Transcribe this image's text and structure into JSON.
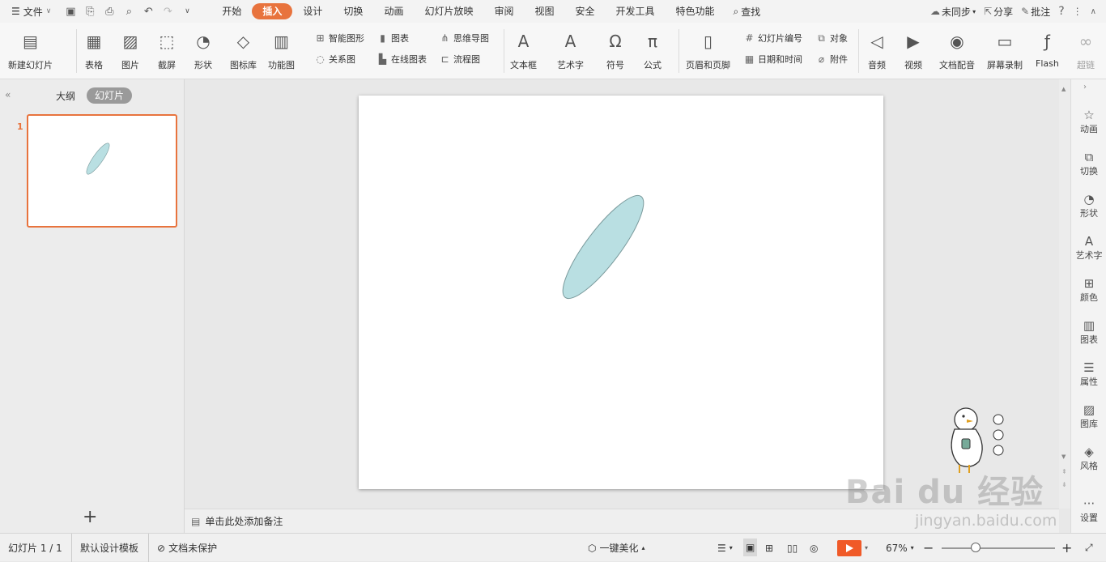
{
  "menubar": {
    "file_label": "文件",
    "tabs": [
      "开始",
      "插入",
      "设计",
      "切换",
      "动画",
      "幻灯片放映",
      "审阅",
      "视图",
      "安全",
      "开发工具",
      "特色功能"
    ],
    "active_tab": 1,
    "search_label": "查找",
    "sync_label": "未同步",
    "share_label": "分享",
    "comment_label": "批注"
  },
  "ribbon": {
    "new_slide": "新建幻灯片",
    "table": "表格",
    "picture": "图片",
    "screenshot": "截屏",
    "shape": "形状",
    "icon_lib": "图标库",
    "func_chart": "功能图",
    "smart_shape": "智能图形",
    "chart": "图表",
    "mindmap": "思维导图",
    "relation": "关系图",
    "online_chart": "在线图表",
    "flowchart": "流程图",
    "textbox": "文本框",
    "wordart": "艺术字",
    "symbol": "符号",
    "formula": "公式",
    "header_footer": "页眉和页脚",
    "slide_number": "幻灯片编号",
    "object": "对象",
    "datetime": "日期和时间",
    "attachment": "附件",
    "audio": "音频",
    "video": "视频",
    "doc_audio": "文档配音",
    "screen_record": "屏幕录制",
    "flash": "Flash",
    "hyperlink": "超链"
  },
  "leftpanel": {
    "outline_tab": "大纲",
    "slides_tab": "幻灯片",
    "slide_num": "1"
  },
  "notes_placeholder": "单击此处添加备注",
  "rightbar": [
    "动画",
    "切换",
    "形状",
    "艺术字",
    "颜色",
    "图表",
    "属性",
    "图库",
    "风格",
    "设置"
  ],
  "statusbar": {
    "slide_pos": "幻灯片 1 / 1",
    "template": "默认设计模板",
    "protection": "文档未保护",
    "beautify": "一键美化",
    "zoom": "67%",
    "zoom_fraction": 0.3
  },
  "slide": {
    "shape_fill": "#b9dfe2",
    "shape_stroke": "#7a9a9c"
  },
  "watermark": {
    "brand": "Bai du 经验",
    "url": "jingyan.baidu.com"
  }
}
